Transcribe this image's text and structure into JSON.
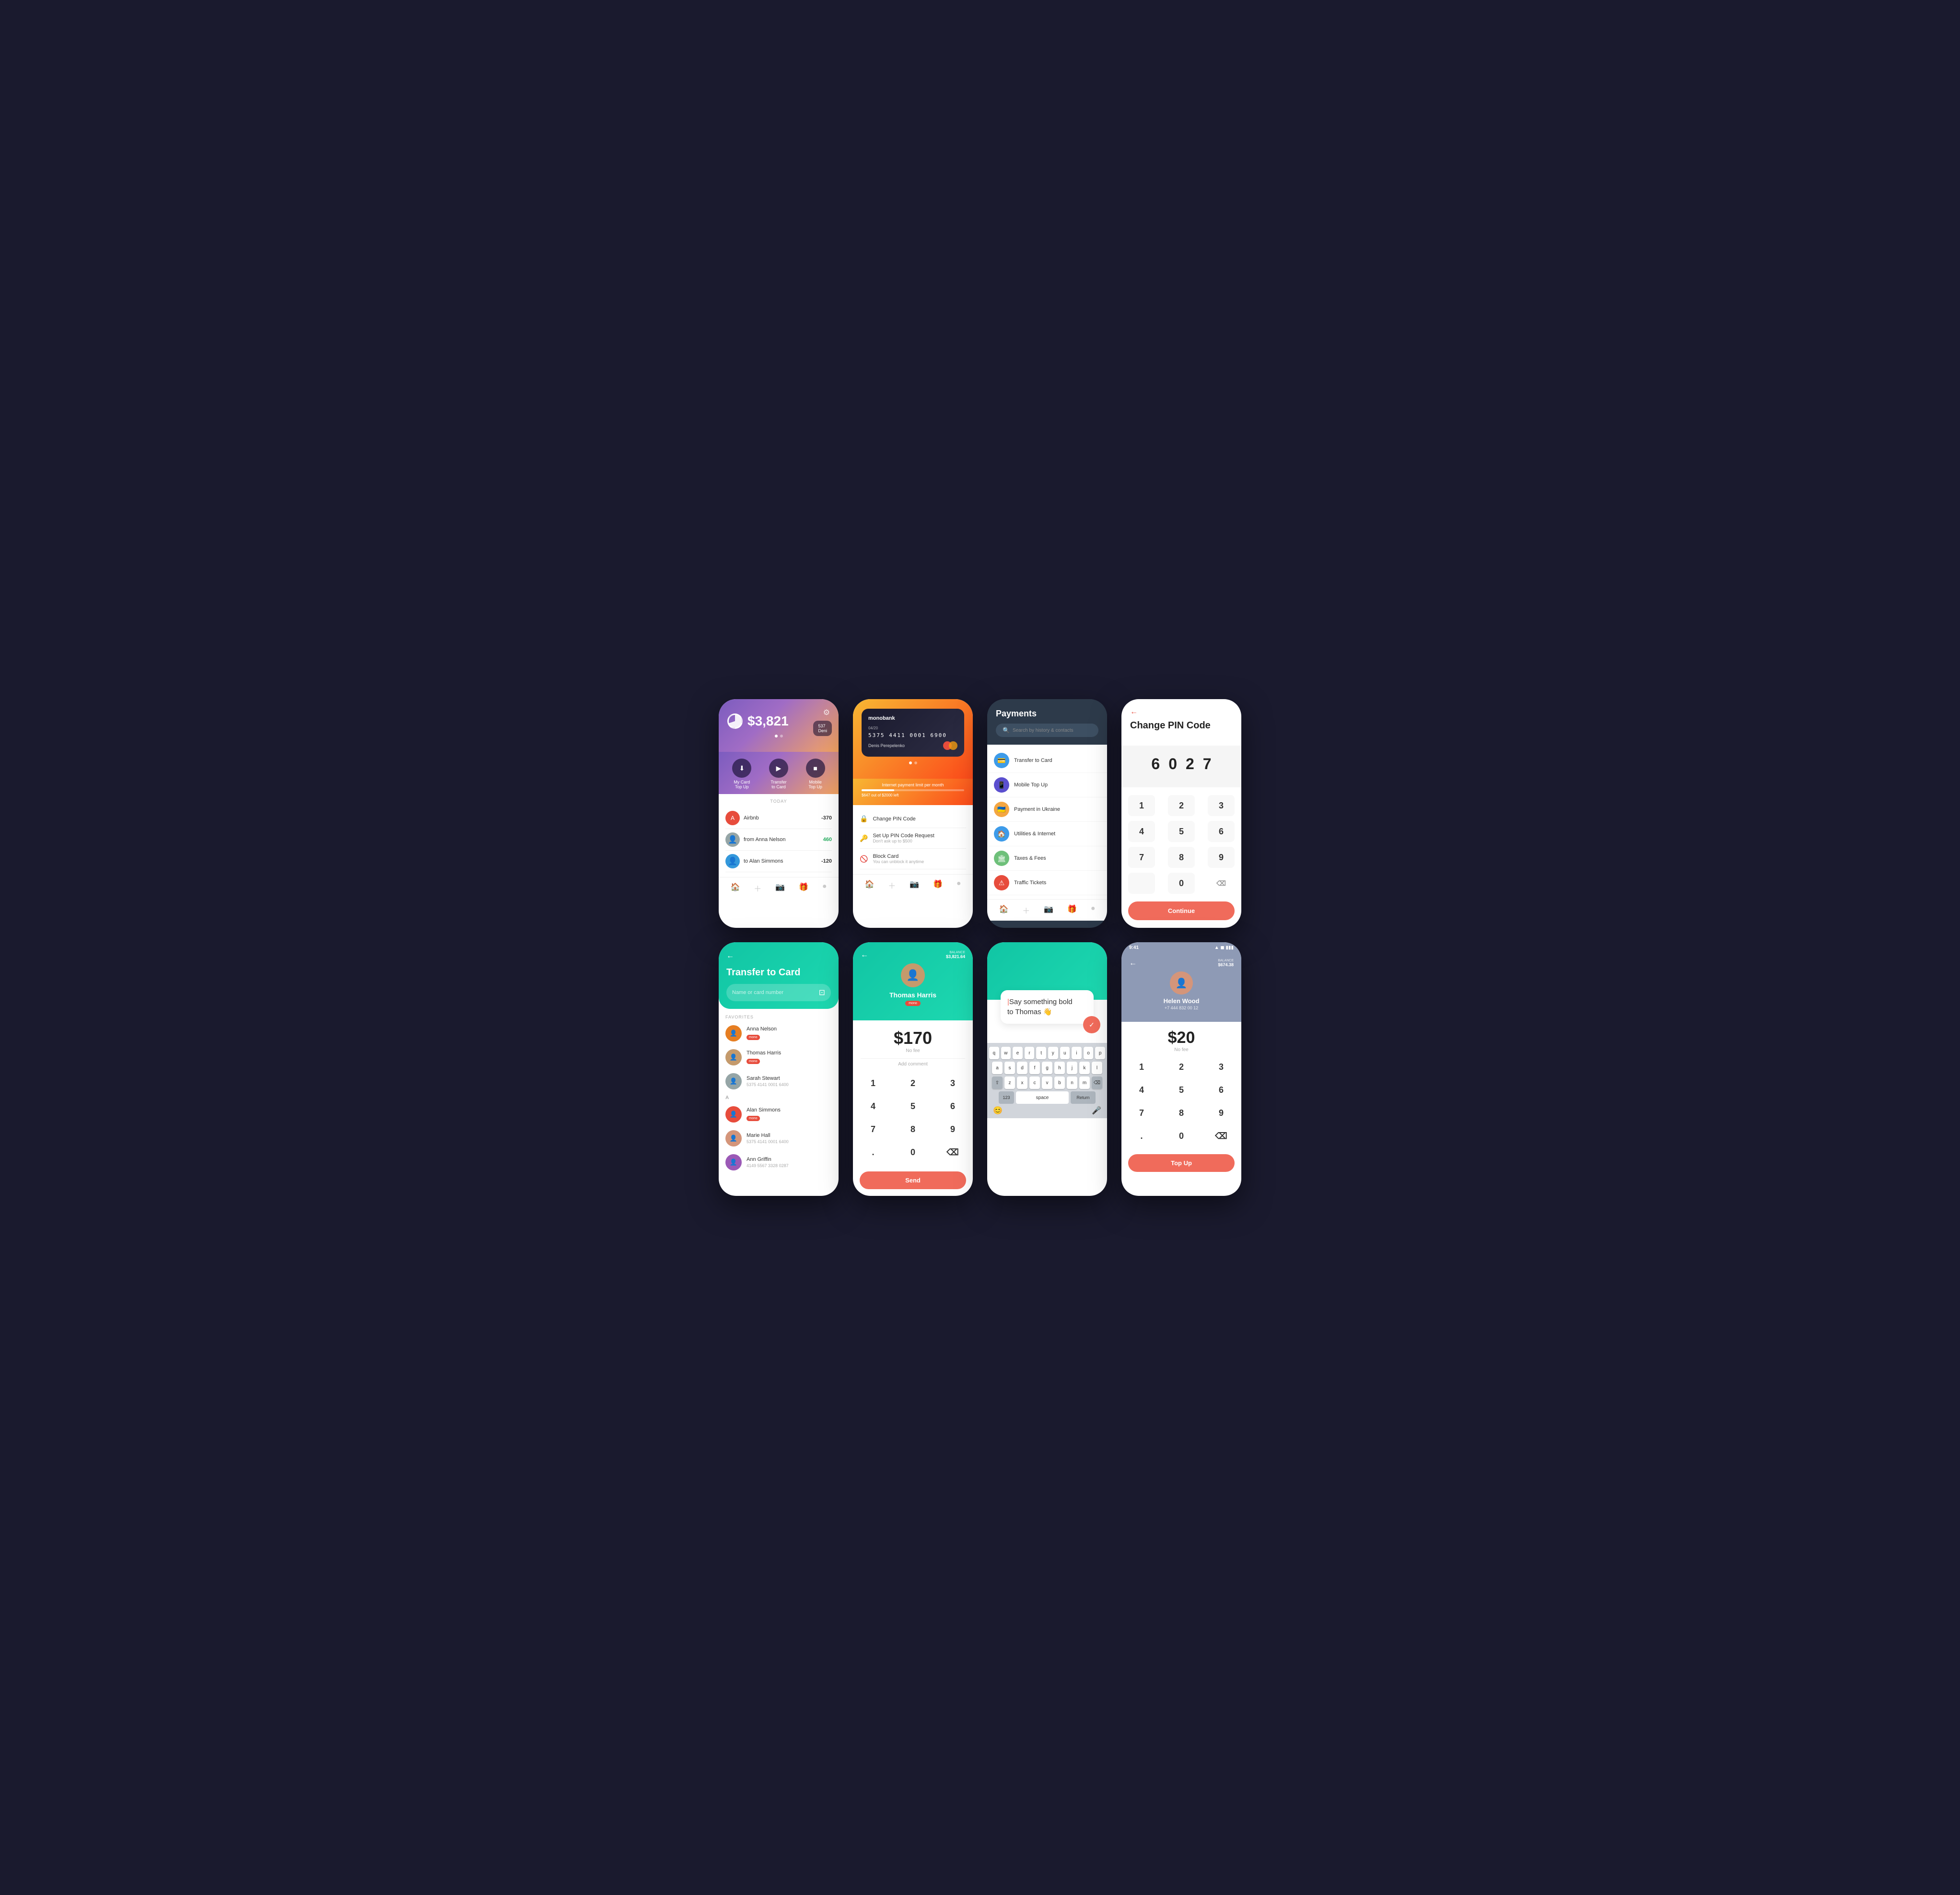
{
  "screens": {
    "s1": {
      "balance": "$3,821",
      "card_preview_number": "537",
      "card_preview_name": "Deni",
      "actions": [
        {
          "label": "My Card\nTop Up",
          "icon": "⬇"
        },
        {
          "label": "Transfer\nto Card",
          "icon": "▶"
        },
        {
          "label": "Mobile\nTop Up",
          "icon": "■"
        }
      ],
      "date_label": "TODAY",
      "transactions": [
        {
          "name": "Airbnb",
          "amount": "-370",
          "pos": false
        },
        {
          "name": "from Anna Nelson",
          "amount": "460",
          "pos": true
        },
        {
          "name": "to Alan Simmons",
          "amount": "-120",
          "pos": false
        }
      ]
    },
    "s2": {
      "bank_name": "monobank",
      "card_number": "5375 4411 0001 6900",
      "card_exp": "04/20",
      "card_holder": "Denis Perepelenko",
      "limit_text": "Internet payment limit per month",
      "limit_used": "$647 out of $2000 left",
      "menu": [
        {
          "title": "Change PIN Code",
          "sub": ""
        },
        {
          "title": "Set Up PIN Code Request",
          "sub": "Don't ask up to $500"
        },
        {
          "title": "Block Card",
          "sub": "You can unblock it anytime"
        }
      ]
    },
    "s3": {
      "title": "Payments",
      "search_placeholder": "Search by history & contacts",
      "items": [
        {
          "label": "Transfer to Card",
          "color": "#3d9be9",
          "icon": "💳"
        },
        {
          "label": "Mobile Top Up",
          "color": "#5b4fcf",
          "icon": "📱"
        },
        {
          "label": "Payment in Ukraine",
          "color": "#f4a642",
          "icon": "🇺🇦"
        },
        {
          "label": "Utilities & Internet",
          "color": "#3d9be9",
          "icon": "🏠"
        },
        {
          "label": "Taxes & Fees",
          "color": "#6ec07a",
          "icon": "🏛"
        },
        {
          "label": "Traffic Tickets",
          "color": "#e74c3c",
          "icon": "⚠"
        }
      ]
    },
    "s4": {
      "back_label": "←",
      "title": "Change PIN Code",
      "pin_digits": [
        "6",
        "0",
        "2",
        "7"
      ],
      "keypad": [
        [
          "1",
          "2",
          "3"
        ],
        [
          "4",
          "5",
          "6"
        ],
        [
          "7",
          "8",
          "9"
        ],
        [
          "",
          "0",
          "⌫"
        ]
      ],
      "continue_label": "Continue"
    },
    "s5": {
      "back_label": "←",
      "title": "Transfer to Card",
      "input_placeholder": "Name or card number",
      "scan_icon": "⊡",
      "favorites_label": "FAVORITES",
      "contacts": [
        {
          "name": "Anna Nelson",
          "badge": "mono",
          "sub": ""
        },
        {
          "name": "Thomas Harris",
          "badge": "mono",
          "sub": ""
        },
        {
          "name": "Sarah Stewart",
          "badge": "",
          "sub": "5375 4141 0001 6400"
        },
        {
          "section": "A"
        },
        {
          "name": "Alan Simmons",
          "badge": "mono",
          "sub": ""
        },
        {
          "name": "Marie Hall",
          "badge": "",
          "sub": "5375 4141 0001 6400"
        },
        {
          "name": "Ann Griffin",
          "badge": "",
          "sub": "4149 5567 3328 0287"
        }
      ]
    },
    "s6": {
      "back_label": "←",
      "balance_label": "BALANCE",
      "balance_val": "$3,821.64",
      "recipient_name": "Thomas Harris",
      "recipient_badge": "mono",
      "amount": "$170",
      "no_fee": "No fee",
      "add_comment": "Add comment",
      "keypad": [
        [
          "1",
          "2",
          "3"
        ],
        [
          "4",
          "5",
          "6"
        ],
        [
          "7",
          "8",
          "9"
        ],
        [
          ".",
          "0",
          "⌫"
        ]
      ],
      "send_label": "Send"
    },
    "s7": {
      "message_text": "Say something bold\nto Thomas 👋",
      "keyboard_rows": [
        [
          "q",
          "w",
          "e",
          "r",
          "t",
          "y",
          "u",
          "i",
          "o",
          "p"
        ],
        [
          "a",
          "s",
          "d",
          "f",
          "g",
          "h",
          "j",
          "k",
          "l"
        ],
        [
          "z",
          "x",
          "c",
          "v",
          "b",
          "n",
          "m"
        ],
        [
          "123",
          "space",
          "Return"
        ]
      ]
    },
    "s8": {
      "status_time": "9:41",
      "back_label": "←",
      "balance_label": "BALANCE",
      "balance_val": "$674.38",
      "recipient_name": "Helen Wood",
      "recipient_phone": "+7 444 832 00 12",
      "amount": "$20",
      "no_fee": "No fee",
      "keypad": [
        [
          "1",
          "2",
          "3"
        ],
        [
          "4",
          "5",
          "6"
        ],
        [
          "7",
          "8",
          "9"
        ],
        [
          ".",
          "0",
          "⌫"
        ]
      ],
      "topup_label": "Top Up"
    }
  }
}
